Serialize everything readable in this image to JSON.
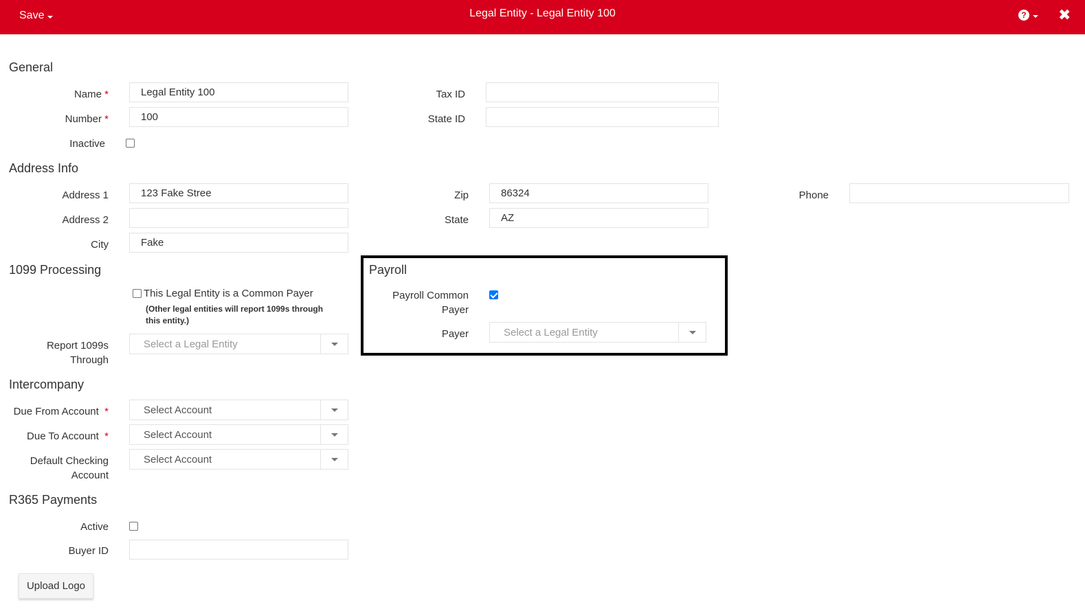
{
  "header": {
    "save_label": "Save",
    "title": "Legal Entity - Legal Entity 100",
    "help_icon": "question-circle-icon",
    "close_icon": "close-icon"
  },
  "general": {
    "heading": "General",
    "name_label": "Name",
    "name_value": "Legal Entity 100",
    "number_label": "Number",
    "number_value": "100",
    "inactive_label": "Inactive",
    "inactive_checked": false,
    "tax_id_label": "Tax ID",
    "tax_id_value": "",
    "state_id_label": "State ID",
    "state_id_value": ""
  },
  "address": {
    "heading": "Address Info",
    "address1_label": "Address 1",
    "address1_value": "123 Fake Stree",
    "address2_label": "Address 2",
    "address2_value": "",
    "city_label": "City",
    "city_value": "Fake",
    "zip_label": "Zip",
    "zip_value": "86324",
    "state_label": "State",
    "state_value": "AZ",
    "phone_label": "Phone",
    "phone_value": ""
  },
  "processing_1099": {
    "heading": "1099 Processing",
    "common_payer_label": "This Legal Entity is a Common Payer",
    "common_payer_note": "(Other legal entities will report 1099s through this entity.)",
    "common_payer_checked": false,
    "report_through_label": "Report 1099s Through",
    "report_through_placeholder": "Select a Legal Entity"
  },
  "payroll": {
    "heading": "Payroll",
    "common_payer_label": "Payroll Common Payer",
    "common_payer_checked": true,
    "payer_label": "Payer",
    "payer_placeholder": "Select a Legal Entity"
  },
  "intercompany": {
    "heading": "Intercompany",
    "due_from_label": "Due From Account",
    "due_from_value": "Select Account",
    "due_to_label": "Due To Account",
    "due_to_value": "Select Account",
    "default_checking_label": "Default Checking Account",
    "default_checking_value": "Select Account"
  },
  "payments": {
    "heading": "R365 Payments",
    "active_label": "Active",
    "active_checked": false,
    "buyer_id_label": "Buyer ID",
    "buyer_id_value": ""
  },
  "upload_logo_label": "Upload Logo",
  "required_marker": "*",
  "colors": {
    "header_bg": "#d6001c",
    "required": "#d6001c",
    "checkbox_checked": "#0075ff"
  }
}
